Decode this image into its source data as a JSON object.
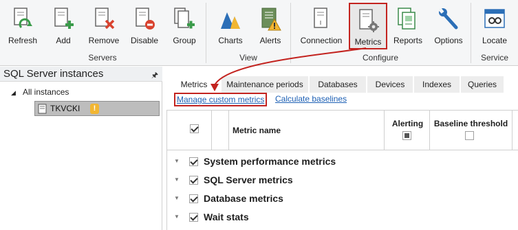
{
  "ribbon": {
    "groups": [
      {
        "title": "Servers",
        "buttons": [
          "Refresh",
          "Add",
          "Remove",
          "Disable",
          "Group"
        ]
      },
      {
        "title": "View",
        "buttons": [
          "Charts",
          "Alerts"
        ]
      },
      {
        "title": "Configure",
        "buttons": [
          "Connection",
          "Metrics",
          "Reports",
          "Options"
        ]
      },
      {
        "title": "Service",
        "buttons": [
          "Locate"
        ]
      }
    ],
    "active_button": "Metrics"
  },
  "left_panel": {
    "title": "SQL Server instances",
    "pin_icon": "pin-icon",
    "tree": {
      "root_label": "All instances",
      "node_label": "TKVCKI",
      "node_icon": "server-icon",
      "node_badge_icon": "warning-icon",
      "node_badge_text": "!"
    }
  },
  "tabs": [
    "Metrics",
    "Maintenance periods",
    "Databases",
    "Devices",
    "Indexes",
    "Queries"
  ],
  "active_tab": "Metrics",
  "links": {
    "manage": "Manage custom metrics",
    "calculate": "Calculate baselines"
  },
  "grid": {
    "headers": {
      "name": "Metric name",
      "alerting": "Alerting",
      "baseline": "Baseline threshold"
    },
    "rows": [
      {
        "label": "System performance metrics",
        "checked": true
      },
      {
        "label": "SQL Server metrics",
        "checked": true
      },
      {
        "label": "Database metrics",
        "checked": true
      },
      {
        "label": "Wait stats",
        "checked": true
      }
    ]
  },
  "colors": {
    "highlight_red": "#c3231f",
    "link_blue": "#1c5fb4",
    "ribbon_bg": "#f5f6f7"
  }
}
